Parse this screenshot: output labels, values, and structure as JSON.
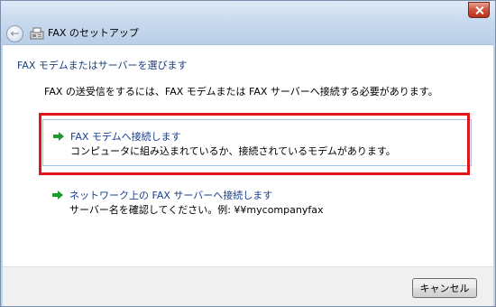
{
  "window": {
    "title": "FAX のセットアップ",
    "back_icon": "←"
  },
  "page": {
    "heading": "FAX モデムまたはサーバーを選びます",
    "description": "FAX の送受信をするには、FAX モデムまたは FAX サーバーへ接続する必要があります。"
  },
  "options": [
    {
      "title": "FAX モデムへ接続します",
      "subtitle": "コンピュータに組み込まれているか、接続されているモデムがあります。"
    },
    {
      "title": "ネットワーク上の FAX サーバーへ接続します",
      "subtitle": "サーバー名を確認してください。例: ¥¥mycompanyfax"
    }
  ],
  "footer": {
    "cancel_label": "キャンセル"
  },
  "colors": {
    "highlight": "#e2141c",
    "arrow": "#1f9a2e",
    "link": "#1a3f8f"
  }
}
